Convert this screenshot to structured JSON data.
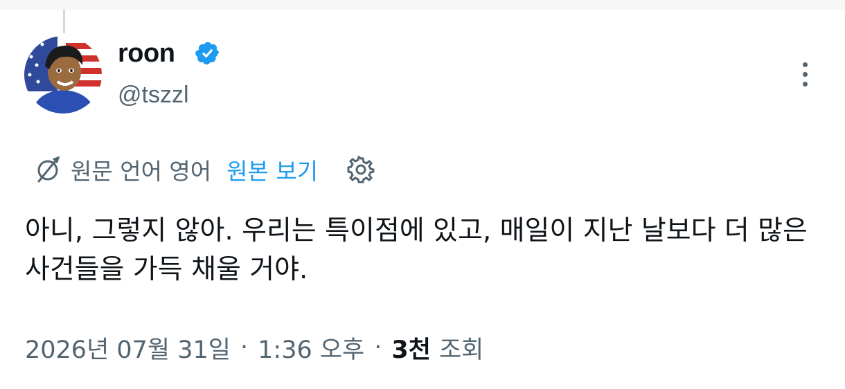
{
  "author": {
    "display_name": "roon",
    "handle": "@tszzl",
    "verified_icon": "verified-badge-icon",
    "avatar_icon": "avatar-image"
  },
  "translation_bar": {
    "source_language_label": "원문 언어 영어",
    "show_original_link": "원본 보기",
    "translate_icon": "translate-icon",
    "settings_icon": "gear-icon"
  },
  "tweet": {
    "text": "아니, 그렇지 않아. 우리는 특이점에 있고, 매일이 지난 날보다 더 많은 사건들을 가득 채울 거야."
  },
  "meta": {
    "date": "2026년 07월 31일",
    "separator1": "·",
    "time": "1:36 오후",
    "separator2": "·",
    "views_count": "3천",
    "views_label": "조회"
  },
  "colors": {
    "text_primary": "#0f1419",
    "text_secondary": "#536471",
    "accent": "#1d9bf0",
    "thread_line": "#cfd9de"
  }
}
